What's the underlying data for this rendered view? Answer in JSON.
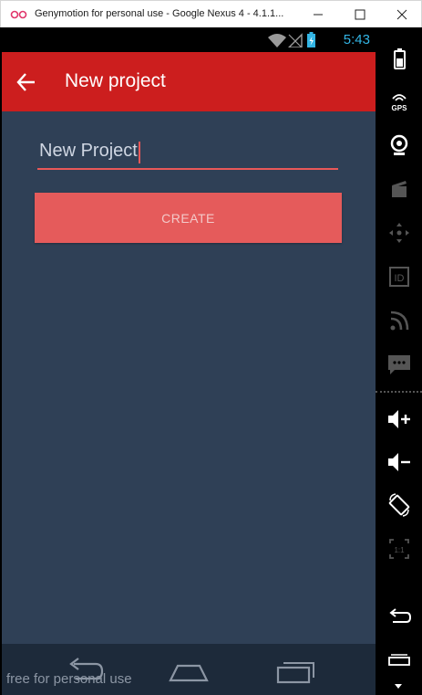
{
  "window": {
    "title": "Genymotion for personal use - Google Nexus 4 - 4.1.1...",
    "icon": "genymotion-logo-icon",
    "controls": [
      "minimize-icon",
      "maximize-icon",
      "close-icon"
    ]
  },
  "status_bar": {
    "time": "5:43",
    "icons": [
      "wifi-icon",
      "signal-icon",
      "battery-icon"
    ],
    "accent": "#33b5e5"
  },
  "toolbar": {
    "title": "New project",
    "back_icon": "arrow-back-icon",
    "color": "#cc1e1e"
  },
  "form": {
    "name_value": "New Project",
    "create_label": "CREATE",
    "button_color": "#e55b5b",
    "underline_color": "#e85858"
  },
  "nav_bar": {
    "buttons": [
      "back-icon",
      "home-icon",
      "recent-apps-icon"
    ]
  },
  "watermark": "free for personal use",
  "side_panel": {
    "buttons": [
      "battery-widget-icon",
      "gps-icon",
      "webcam-icon",
      "screencast-icon",
      "dpad-icon",
      "device-id-icon",
      "network-icon",
      "sms-icon",
      "volume-up-icon",
      "volume-down-icon",
      "rotate-icon",
      "pixel-perfect-icon",
      "back-icon",
      "menu-icon"
    ],
    "gps_label": "GPS",
    "id_label": "ID",
    "pixel_label": "1:1"
  },
  "colors": {
    "app_background": "#2f4056"
  }
}
